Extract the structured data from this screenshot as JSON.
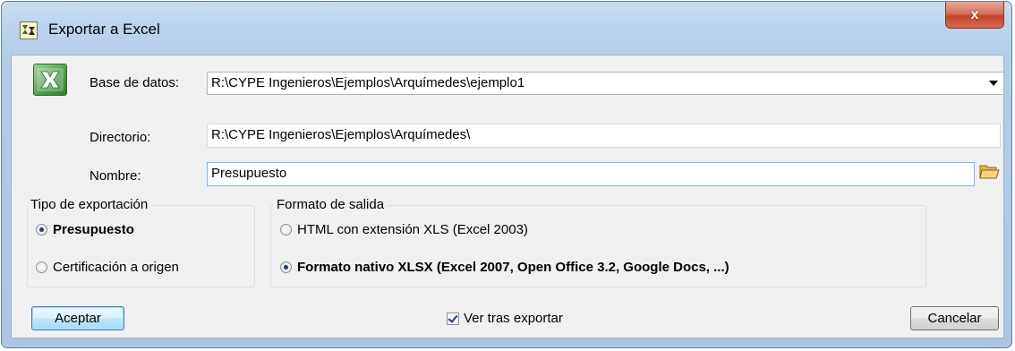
{
  "window": {
    "title": "Exportar a Excel",
    "close_label": "x"
  },
  "form": {
    "base_datos_label": "Base de datos:",
    "base_datos_value": "R:\\CYPE Ingenieros\\Ejemplos\\Arquímedes\\ejemplo1",
    "directorio_label": "Directorio:",
    "directorio_value": "R:\\CYPE Ingenieros\\Ejemplos\\Arquímedes\\",
    "nombre_label": "Nombre:",
    "nombre_value": "Presupuesto"
  },
  "tipo_exportacion": {
    "legend": "Tipo de exportación",
    "options": [
      {
        "label": "Presupuesto",
        "selected": true
      },
      {
        "label": "Certificación a origen",
        "selected": false
      }
    ]
  },
  "formato_salida": {
    "legend": "Formato de salida",
    "options": [
      {
        "label": "HTML con extensión XLS  (Excel 2003)",
        "selected": false
      },
      {
        "label": "Formato nativo XLSX (Excel 2007, Open Office 3.2, Google Docs, ...)",
        "selected": true
      }
    ]
  },
  "footer": {
    "accept_label": "Aceptar",
    "view_after_label": "Ver tras exportar",
    "view_after_checked": true,
    "cancel_label": "Cancelar"
  },
  "icons": {
    "app": "app-icon",
    "excel": "excel-icon",
    "folder": "open-folder-icon",
    "dropdown": "chevron-down-icon"
  }
}
